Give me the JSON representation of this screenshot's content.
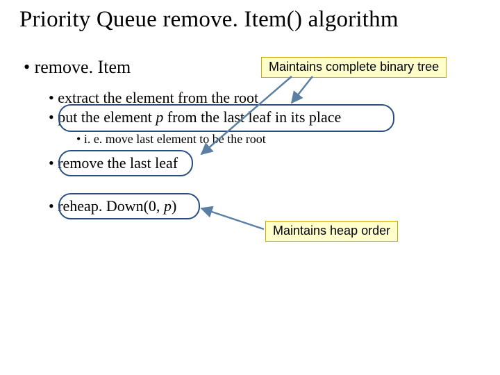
{
  "title": "Priority Queue remove. Item() algorithm",
  "items": {
    "heading": "remove. Item",
    "extract": "extract the element from the root",
    "put_prefix": "put the element ",
    "put_var": "p",
    "put_suffix": " from the last leaf in its place",
    "put_note": "i. e. move last element to be the root",
    "remove_leaf": "remove the last leaf",
    "reheap_prefix": "reheap. Down(0, ",
    "reheap_var": "p",
    "reheap_suffix": ")"
  },
  "callouts": {
    "tree": "Maintains complete binary tree",
    "heap": "Maintains heap order"
  }
}
